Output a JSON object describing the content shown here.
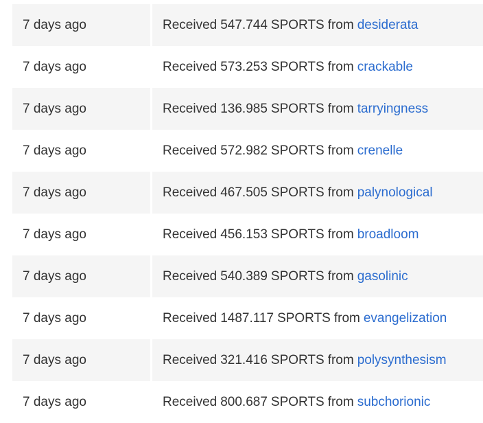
{
  "rows": [
    {
      "time": "7 days ago",
      "prefix": "Received",
      "amount": "547.744",
      "token": "SPORTS",
      "from_label": "from",
      "sender": "desiderata"
    },
    {
      "time": "7 days ago",
      "prefix": "Received",
      "amount": "573.253",
      "token": "SPORTS",
      "from_label": "from",
      "sender": "crackable"
    },
    {
      "time": "7 days ago",
      "prefix": "Received",
      "amount": "136.985",
      "token": "SPORTS",
      "from_label": "from",
      "sender": "tarryingness"
    },
    {
      "time": "7 days ago",
      "prefix": "Received",
      "amount": "572.982",
      "token": "SPORTS",
      "from_label": "from",
      "sender": "crenelle"
    },
    {
      "time": "7 days ago",
      "prefix": "Received",
      "amount": "467.505",
      "token": "SPORTS",
      "from_label": "from",
      "sender": "palynological"
    },
    {
      "time": "7 days ago",
      "prefix": "Received",
      "amount": "456.153",
      "token": "SPORTS",
      "from_label": "from",
      "sender": "broadloom"
    },
    {
      "time": "7 days ago",
      "prefix": "Received",
      "amount": "540.389",
      "token": "SPORTS",
      "from_label": "from",
      "sender": "gasolinic"
    },
    {
      "time": "7 days ago",
      "prefix": "Received",
      "amount": "1487.117",
      "token": "SPORTS",
      "from_label": "from",
      "sender": "evangelization"
    },
    {
      "time": "7 days ago",
      "prefix": "Received",
      "amount": "321.416",
      "token": "SPORTS",
      "from_label": "from",
      "sender": "polysynthesism"
    },
    {
      "time": "7 days ago",
      "prefix": "Received",
      "amount": "800.687",
      "token": "SPORTS",
      "from_label": "from",
      "sender": "subchorionic"
    }
  ],
  "colors": {
    "link": "#2b6ccf",
    "text": "#333333",
    "stripe": "#f5f5f5"
  }
}
